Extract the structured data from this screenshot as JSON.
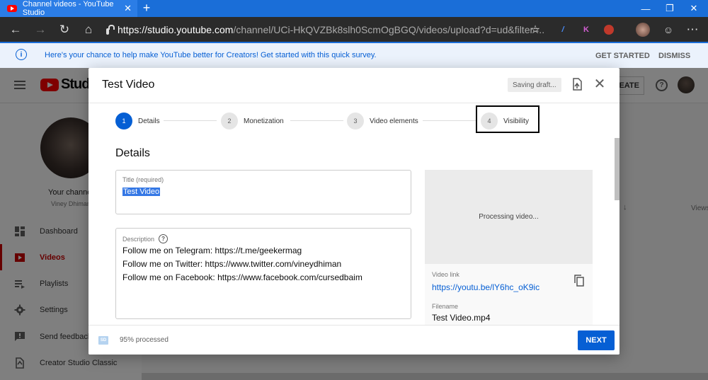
{
  "browser": {
    "tab_title": "Channel videos - YouTube Studio",
    "tab_close": "✕",
    "new_tab": "+",
    "url_main": "https://studio.youtube.com",
    "url_rest": "/channel/UCi-HkQVZBk8slh0ScmOgBGQ/videos/upload?d=ud&filter=...",
    "ext_k": "K"
  },
  "banner": {
    "message": "Here's your chance to help make YouTube better for Creators! Get started with this quick survey.",
    "get_started": "GET STARTED",
    "dismiss": "DISMISS"
  },
  "studio": {
    "logo_text": "Studio",
    "create_label": "EATE",
    "channel_title": "Your channel",
    "channel_owner": "Viney Dhiman",
    "nav": [
      {
        "label": "Dashboard"
      },
      {
        "label": "Videos"
      },
      {
        "label": "Playlists"
      },
      {
        "label": "Settings"
      },
      {
        "label": "Send feedback"
      },
      {
        "label": "Creator Studio Classic"
      }
    ],
    "views_header": "Views"
  },
  "dialog": {
    "title": "Test Video",
    "saving": "Saving draft...",
    "steps": [
      {
        "num": "1",
        "label": "Details"
      },
      {
        "num": "2",
        "label": "Monetization"
      },
      {
        "num": "3",
        "label": "Video elements"
      },
      {
        "num": "4",
        "label": "Visibility"
      }
    ],
    "section_title": "Details",
    "title_field": {
      "label": "Title (required)",
      "value": "Test Video"
    },
    "description_field": {
      "label": "Description",
      "lines": [
        "Follow me on Telegram: https://t.me/geekermag",
        "Follow me on Twitter: https://www.twitter.com/vineydhiman",
        "Follow me on Facebook: https://www.facebook.com/cursedbaim"
      ]
    },
    "preview": {
      "processing": "Processing video...",
      "video_link_label": "Video link",
      "video_link": "https://youtu.be/lY6hc_oK9ic",
      "filename_label": "Filename",
      "filename": "Test Video.mp4"
    },
    "footer": {
      "badge": "SD",
      "processed": "95% processed",
      "next": "NEXT"
    }
  },
  "colors": {
    "accent": "#065fd4",
    "brand_red": "#ff0000",
    "chrome_dark": "#2b2b2b",
    "tab_blue": "#1a6ed8"
  }
}
